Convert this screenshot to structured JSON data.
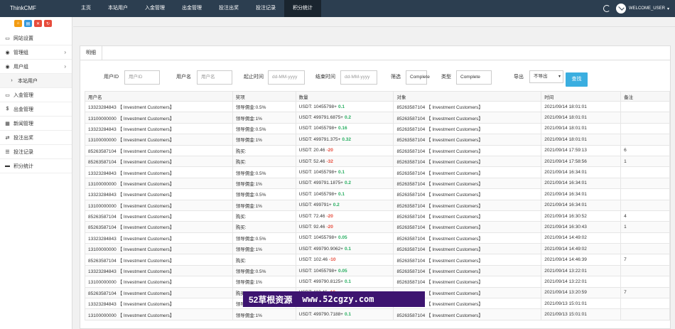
{
  "brand": "ThinkCMF",
  "nav": [
    "主页",
    "本站用户",
    "入金管理",
    "出金管理",
    "投注出奖",
    "投注记录",
    "积分统计"
  ],
  "user": "WELCOME_USER",
  "sidebar": [
    {
      "label": "网站设置",
      "icon": "monitor-icon"
    },
    {
      "label": "管理组",
      "icon": "user-circle-icon"
    },
    {
      "label": "用户组",
      "icon": "user-circle-icon"
    },
    {
      "label": "本站用户",
      "icon": "chevron-right-icon"
    },
    {
      "label": "入金管理",
      "icon": "monitor-icon"
    },
    {
      "label": "出金管理",
      "icon": "dollar-icon"
    },
    {
      "label": "新闻管理",
      "icon": "news-icon"
    },
    {
      "label": "投注出奖",
      "icon": "exchange-icon"
    },
    {
      "label": "投注记录",
      "icon": "list-icon"
    },
    {
      "label": "积分统计",
      "icon": "visa-icon"
    }
  ],
  "tab": "明细",
  "filters": {
    "userid_label": "用户ID",
    "userid_ph": "用户ID",
    "username_label": "用户名",
    "username_ph": "用户名",
    "start_label": "起止时间",
    "start_ph": "dd-MM-yyyy",
    "end_label": "结束时间",
    "end_ph": "dd-MM-yyyy",
    "filter_label": "筛选",
    "filter_val": "Complete",
    "type_label": "类型",
    "type_val": "Complete",
    "export_label": "导出",
    "export_val": "不导出",
    "search_btn": "查找"
  },
  "table": {
    "headers": [
      "用户名",
      "奖项",
      "数量",
      "对象",
      "时间",
      "备注"
    ],
    "rows": [
      [
        "13323284843 【 Investment Customers】",
        "领导佣金:0.5%",
        "USDT: 10455798+",
        "0.1",
        "pos",
        "85263587104 【 Investment Customers】",
        "2021/09/14 18:01:01",
        ""
      ],
      [
        "13100000000 【 Investment Customers】",
        "领导佣金:1%",
        "USDT: 499791.6875+",
        "0.2",
        "pos",
        "85263587104 【 Investment Customers】",
        "2021/09/14 18:01:01",
        ""
      ],
      [
        "13323284843 【 Investment Customers】",
        "领导佣金:0.5%",
        "USDT: 10455798+",
        "0.16",
        "pos",
        "85263587104 【 Investment Customers】",
        "2021/09/14 18:01:01",
        ""
      ],
      [
        "13100000000 【 Investment Customers】",
        "领导佣金:1%",
        "USDT: 499791.375+",
        "0.32",
        "pos",
        "85263587104 【 Investment Customers】",
        "2021/09/14 18:01:01",
        ""
      ],
      [
        "85263587104 【 Investment Customers】",
        "购买:",
        "USDT: 20.46",
        "-20",
        "neg",
        "85263587104 【 Investment Customers】",
        "2021/09/14 17:59:13",
        "6"
      ],
      [
        "85263587104 【 Investment Customers】",
        "购买:",
        "USDT: 52.46",
        "-32",
        "neg",
        "85263587104 【 Investment Customers】",
        "2021/09/14 17:58:56",
        "1"
      ],
      [
        "13323284843 【 Investment Customers】",
        "领导佣金:0.5%",
        "USDT: 10455798+",
        "0.1",
        "pos",
        "85263587104 【 Investment Customers】",
        "2021/09/14 16:34:01",
        ""
      ],
      [
        "13100000000 【 Investment Customers】",
        "领导佣金:1%",
        "USDT: 499791.1875+",
        "0.2",
        "pos",
        "85263587104 【 Investment Customers】",
        "2021/09/14 16:34:01",
        ""
      ],
      [
        "13323284843 【 Investment Customers】",
        "领导佣金:0.5%",
        "USDT: 10455798+",
        "0.1",
        "pos",
        "85263587104 【 Investment Customers】",
        "2021/09/14 16:34:01",
        ""
      ],
      [
        "13100000000 【 Investment Customers】",
        "领导佣金:1%",
        "USDT: 499791+",
        "0.2",
        "pos",
        "85263587104 【 Investment Customers】",
        "2021/09/14 16:34:01",
        ""
      ],
      [
        "85263587104 【 Investment Customers】",
        "购买:",
        "USDT: 72.46",
        "-20",
        "neg",
        "85263587104 【 Investment Customers】",
        "2021/09/14 16:30:52",
        "4"
      ],
      [
        "85263587104 【 Investment Customers】",
        "购买:",
        "USDT: 92.46",
        "-20",
        "neg",
        "85263587104 【 Investment Customers】",
        "2021/09/14 16:30:43",
        "1"
      ],
      [
        "13323284843 【 Investment Customers】",
        "领导佣金:0.5%",
        "USDT: 10455798+",
        "0.05",
        "pos",
        "85263587104 【 Investment Customers】",
        "2021/09/14 14:49:02",
        ""
      ],
      [
        "13100000000 【 Investment Customers】",
        "领导佣金:1%",
        "USDT: 499790.9062+",
        "0.1",
        "pos",
        "85263587104 【 Investment Customers】",
        "2021/09/14 14:49:02",
        ""
      ],
      [
        "85263587104 【 Investment Customers】",
        "购买:",
        "USDT: 102.46",
        "-10",
        "neg",
        "85263587104 【 Investment Customers】",
        "2021/09/14 14:46:39",
        "7"
      ],
      [
        "13323284843 【 Investment Customers】",
        "领导佣金:0.5%",
        "USDT: 10455798+",
        "0.05",
        "pos",
        "85263587104 【 Investment Customers】",
        "2021/09/14 13:22:01",
        ""
      ],
      [
        "13100000000 【 Investment Customers】",
        "领导佣金:1%",
        "USDT: 499790.8125+",
        "0.1",
        "pos",
        "85263587104 【 Investment Customers】",
        "2021/09/14 13:22:01",
        ""
      ],
      [
        "85263587104 【 Investment Customers】",
        "购买:",
        "USDT: 112.46",
        "-10",
        "neg",
        "85263587104 【 Investment Customers】",
        "2021/09/14 13:20:59",
        "7"
      ],
      [
        "13323284843 【 Investment Customers】",
        "领导佣金:0.5%",
        "USDT: 10455798+",
        "0.05",
        "pos",
        "85263587104 【 Investment Customers】",
        "2021/09/13 15:01:01",
        ""
      ],
      [
        "13100000000 【 Investment Customers】",
        "领导佣金:1%",
        "USDT: 499790.7188+",
        "0.1",
        "pos",
        "85263587104 【 Investment Customers】",
        "2021/09/13 15:01:01",
        ""
      ]
    ]
  },
  "watermark": {
    "cn": "52草根资源",
    "url": "www.52cgzy.com"
  }
}
